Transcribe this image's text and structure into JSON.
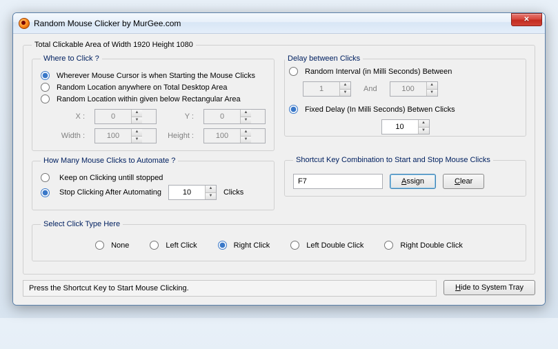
{
  "title": "Random Mouse Clicker by MurGee.com",
  "outer_legend": "Total Clickable Area of Width 1920 Height 1080",
  "where": {
    "legend": "Where to Click ?",
    "opt_cursor": "Wherever Mouse Cursor is when Starting the Mouse Clicks",
    "opt_desktop": "Random Location anywhere on Total Desktop Area",
    "opt_rect": "Random Location within given below Rectangular Area",
    "x_label": "X :",
    "y_label": "Y :",
    "w_label": "Width :",
    "h_label": "Height :",
    "x": "0",
    "y": "0",
    "w": "100",
    "h": "100"
  },
  "delay": {
    "legend": "Delay between Clicks",
    "opt_random": "Random Interval (in Milli Seconds) Between",
    "opt_fixed": "Fixed Delay (In Milli Seconds) Betwen Clicks",
    "rand_from": "1",
    "and_label": "And",
    "rand_to": "100",
    "fixed": "10"
  },
  "howmany": {
    "legend": "How Many Mouse Clicks to Automate ?",
    "opt_forever": "Keep on Clicking untill stopped",
    "opt_after": "Stop Clicking After Automating",
    "count": "10",
    "clicks_label": "Clicks"
  },
  "shortcut": {
    "legend": "Shortcut Key Combination to Start and Stop Mouse Clicks",
    "value": "F7",
    "assign": "Assign",
    "clear": "Clear"
  },
  "clicktype": {
    "legend": "Select Click Type Here",
    "none": "None",
    "left": "Left Click",
    "right": "Right Click",
    "leftdbl": "Left Double Click",
    "rightdbl": "Right Double Click"
  },
  "status": "Press the Shortcut Key to Start Mouse Clicking.",
  "hide": "Hide to System Tray"
}
